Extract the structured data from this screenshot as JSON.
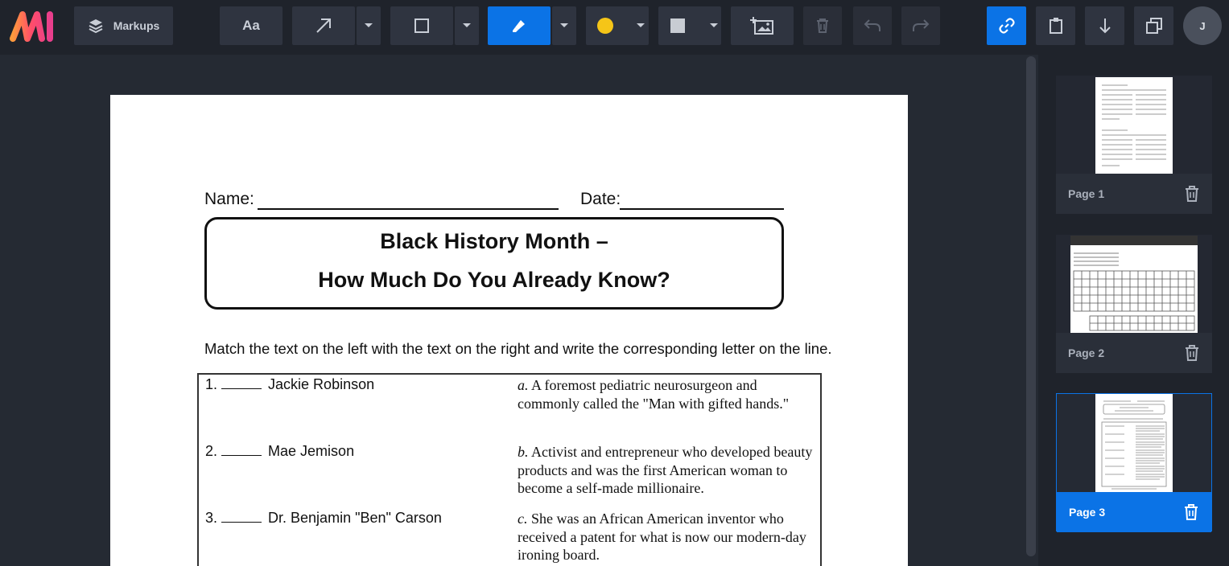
{
  "toolbar": {
    "markups_label": "Markups",
    "text_tool_label": "Aa",
    "highlight_color": "#f5c518",
    "fill_color": "#c8ccd3",
    "accent_color": "#0b73e6",
    "user_initial": "J"
  },
  "document": {
    "name_label": "Name:",
    "date_label": "Date:",
    "title_line1": "Black History Month –",
    "title_line2": "How Much Do You Already Know?",
    "instructions": "Match the text on the left with the text on the right and write the corresponding letter on the line.",
    "questions": [
      {
        "number": "1.",
        "text": "Jackie Robinson"
      },
      {
        "number": "2.",
        "text": "Mae Jemison"
      },
      {
        "number": "3.",
        "text": "Dr. Benjamin \"Ben\" Carson"
      }
    ],
    "answers": [
      {
        "letter": "a.",
        "text": "A foremost pediatric neurosurgeon and commonly called the \"Man with gifted hands.\""
      },
      {
        "letter": "b.",
        "text": "Activist and entrepreneur who developed beauty products and was the first American woman to become a self-made millionaire."
      },
      {
        "letter": "c.",
        "text": "She was an African American inventor who received a patent for what is now our modern-day ironing board."
      }
    ]
  },
  "pages": {
    "items": [
      {
        "label": "Page 1",
        "selected": false
      },
      {
        "label": "Page 2",
        "selected": false
      },
      {
        "label": "Page 3",
        "selected": true
      }
    ]
  }
}
